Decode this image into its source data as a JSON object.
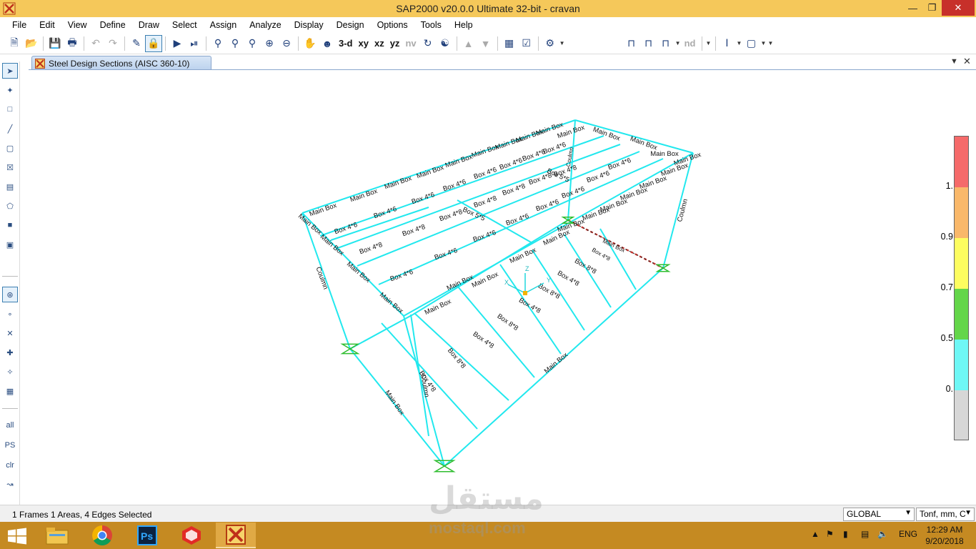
{
  "window": {
    "title": "SAP2000 v20.0.0 Ultimate 32-bit - cravan"
  },
  "menu": [
    "File",
    "Edit",
    "View",
    "Define",
    "Draw",
    "Select",
    "Assign",
    "Analyze",
    "Display",
    "Design",
    "Options",
    "Tools",
    "Help"
  ],
  "toolbar": {
    "view_3d": "3-d",
    "view_xy": "xy",
    "view_xz": "xz",
    "view_yz": "yz",
    "view_nv": "nv",
    "nd": "nd"
  },
  "left_toolbar": {
    "all": "all",
    "ps": "PS",
    "clr": "clr"
  },
  "tab": {
    "label": "Steel Design Sections  (AISC 360-10)"
  },
  "model": {
    "member_labels": [
      "Main Box",
      "Box 4*6",
      "Box 4*8",
      "Box 5*5",
      "Box 8*8",
      "Coulmn"
    ],
    "axis": {
      "x": "X",
      "y": "Y",
      "z": "Z"
    }
  },
  "legend": {
    "labels": [
      "1.",
      "0.9",
      "0.7",
      "0.5",
      "0."
    ],
    "colors": [
      "#f56a6a",
      "#f9b86a",
      "#fdfd60",
      "#64d64a",
      "#6ef7f5",
      "#d7d7d7"
    ]
  },
  "status": {
    "selection": "1 Frames  1 Areas, 4 Edges Selected",
    "coord_system": "GLOBAL",
    "units": "Tonf, mm, C"
  },
  "taskbar": {
    "language": "ENG",
    "time": "12:29 AM",
    "date": "9/20/2018"
  },
  "watermark": {
    "arabic": "مستقل",
    "latin": "mostaql.com"
  }
}
